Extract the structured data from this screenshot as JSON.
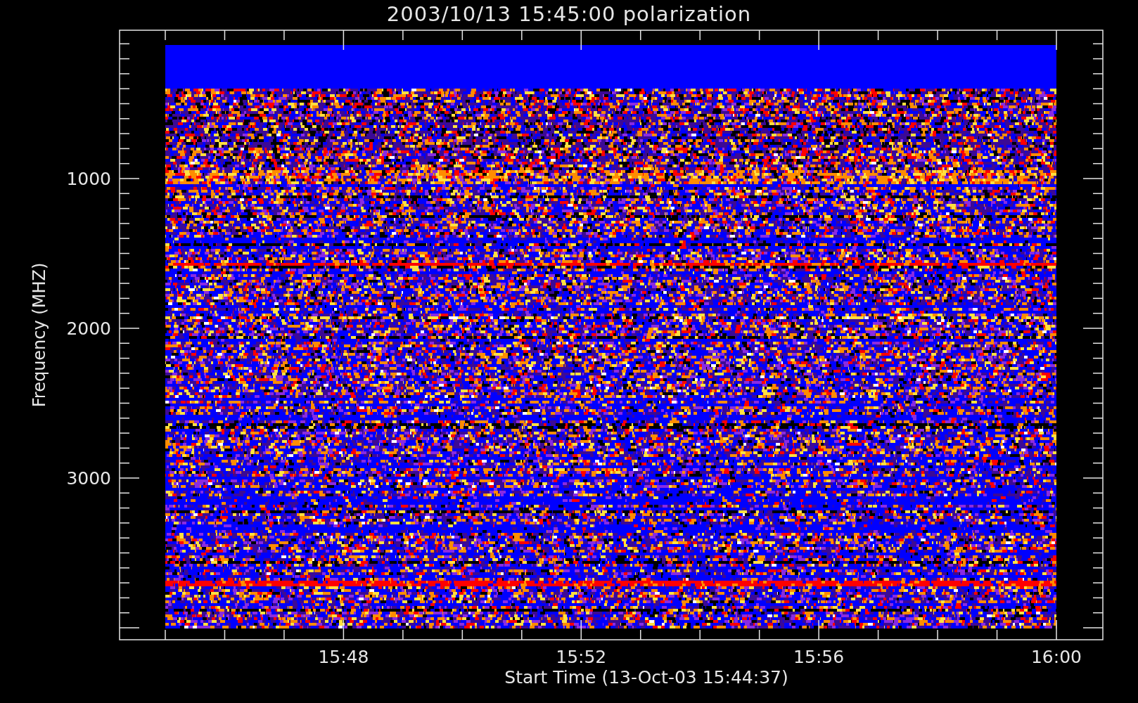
{
  "title": "2003/10/13 15:45:00 polarization",
  "x_axis": {
    "label": "Start Time (13-Oct-03 15:44:37)",
    "ticks": [
      "15:48",
      "15:52",
      "15:56",
      "16:00"
    ]
  },
  "y_axis": {
    "label": "Frequency (MHZ)",
    "ticks": [
      "1000",
      "2000",
      "3000"
    ]
  }
}
